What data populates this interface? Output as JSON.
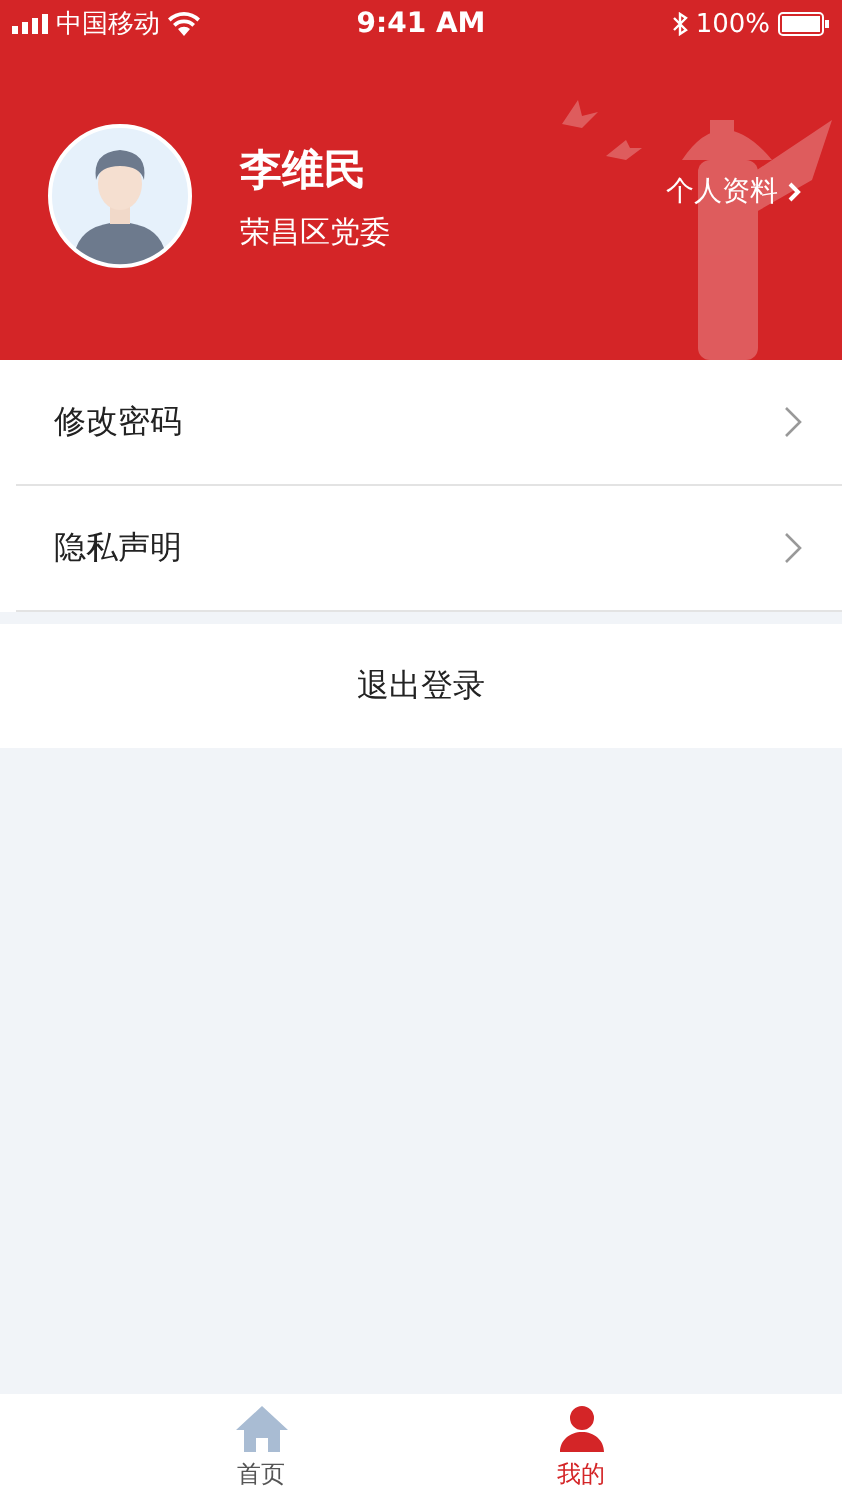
{
  "status_bar": {
    "carrier": "中国移动",
    "time": "9:41 AM",
    "battery": "100%"
  },
  "profile": {
    "name": "李维民",
    "organization": "荣昌区党委",
    "details_link": "个人资料"
  },
  "menu": [
    {
      "label": "修改密码"
    },
    {
      "label": "隐私声明"
    }
  ],
  "logout": "退出登录",
  "tab_bar": [
    {
      "label": "首页",
      "kind": "home",
      "selected": false
    },
    {
      "label": "我的",
      "kind": "person",
      "selected": true
    }
  ]
}
